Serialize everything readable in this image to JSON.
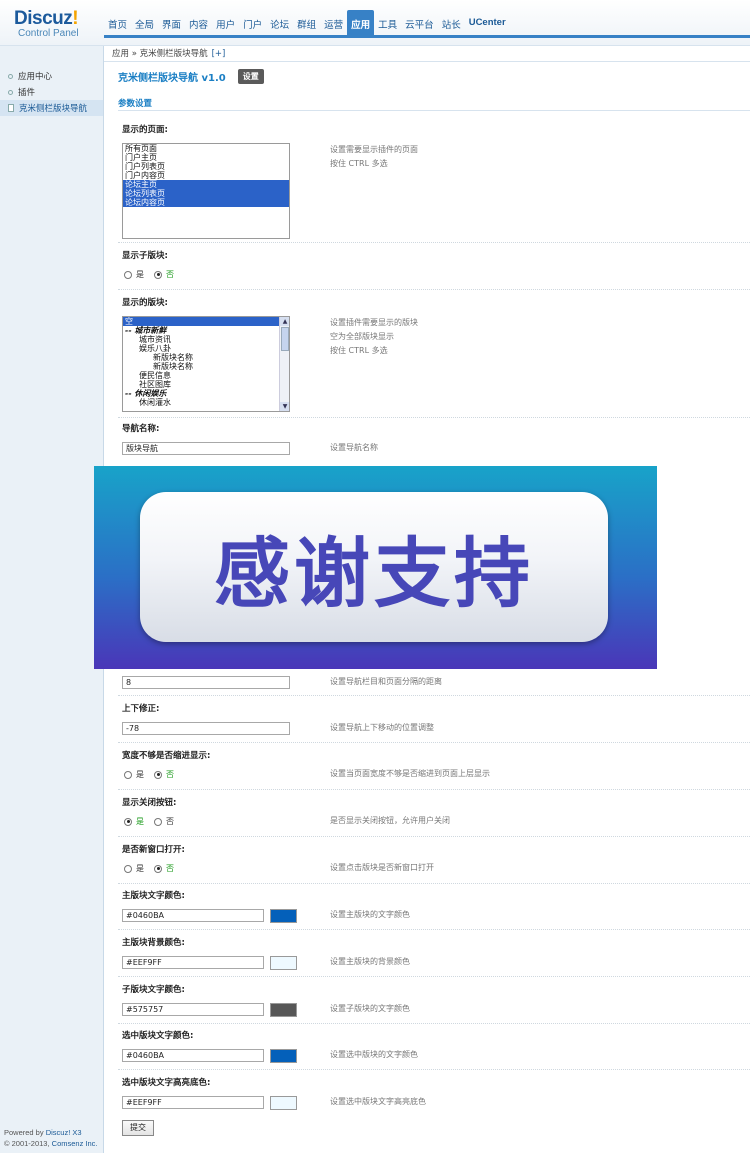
{
  "logo": {
    "main": "Discuz",
    "bang": "!",
    "sub": "Control Panel"
  },
  "topnav": [
    "首页",
    "全局",
    "界面",
    "内容",
    "用户",
    "门户",
    "论坛",
    "群组",
    "运营",
    "应用",
    "工具",
    "云平台",
    "站长",
    "UCenter"
  ],
  "active_tab": "应用",
  "sidebar": {
    "items": [
      "应用中心",
      "插件",
      "克米侧栏版块导航"
    ]
  },
  "footer": {
    "line1_prefix": "Powered by ",
    "line1_brand": "Discuz! X3",
    "line2_prefix": "© 2001-2013, ",
    "line2_brand": "Comsenz Inc."
  },
  "breadcrumb": {
    "text": "应用 » 克米侧栏版块导航",
    "plus": "[+]"
  },
  "plugin": {
    "title": "克米侧栏版块导航 v1.0",
    "settings": "设置"
  },
  "section": "参数设置",
  "pages": {
    "label": "显示的页面:",
    "options": [
      "所有页面",
      "门户主页",
      "门户列表页",
      "门户内容页",
      "论坛主页",
      "论坛列表页",
      "论坛内容页"
    ],
    "selected": [
      "论坛主页",
      "论坛列表页",
      "论坛内容页"
    ],
    "hint1": "设置需要显示插件的页面",
    "hint2": "按住 CTRL 多选"
  },
  "subforum": {
    "label": "显示子版块:",
    "yes": "是",
    "no": "否",
    "value": "否"
  },
  "forums": {
    "label": "显示的版块:",
    "options": [
      "空",
      "-- 城市新鲜",
      "城市资讯",
      "娱乐八卦",
      "新版块名称",
      "新版块名称",
      "便民信息",
      "社区图库",
      "-- 休闲娱乐",
      "休闲灌水"
    ],
    "hint1": "设置插件需要显示的版块",
    "hint2": "空为全部版块显示",
    "hint3": "按住 CTRL 多选"
  },
  "navname": {
    "label": "导航名称:",
    "value": "版块导航",
    "hint": "设置导航名称"
  },
  "distance": {
    "value": "8",
    "hint": "设置导航栏目和页面分隔的距离"
  },
  "offset": {
    "label": "上下修正:",
    "value": "-78",
    "hint": "设置导航上下移动的位置调整"
  },
  "narrow": {
    "label": "宽度不够是否缩进显示:",
    "yes": "是",
    "no": "否",
    "value": "否",
    "hint": "设置当页面宽度不够是否缩进到页面上层显示"
  },
  "closebtn": {
    "label": "显示关闭按钮:",
    "yes": "是",
    "no": "否",
    "value": "是",
    "hint": "是否显示关闭按钮，允许用户关闭"
  },
  "newwin": {
    "label": "是否新窗口打开:",
    "yes": "是",
    "no": "否",
    "value": "否",
    "hint": "设置点击版块是否新窗口打开"
  },
  "colors": [
    {
      "label": "主版块文字颜色:",
      "value": "#0460BA",
      "hint": "设置主版块的文字颜色"
    },
    {
      "label": "主版块背景颜色:",
      "value": "#EEF9FF",
      "hint": "设置主版块的背景颜色"
    },
    {
      "label": "子版块文字颜色:",
      "value": "#575757",
      "hint": "设置子版块的文字颜色"
    },
    {
      "label": "选中版块文字颜色:",
      "value": "#0460BA",
      "hint": "设置选中版块的文字颜色"
    },
    {
      "label": "选中版块文字高亮底色:",
      "value": "#EEF9FF",
      "hint": "设置选中版块文字高亮底色"
    }
  ],
  "submit": "提交",
  "banner": {
    "text": "感谢支持"
  }
}
